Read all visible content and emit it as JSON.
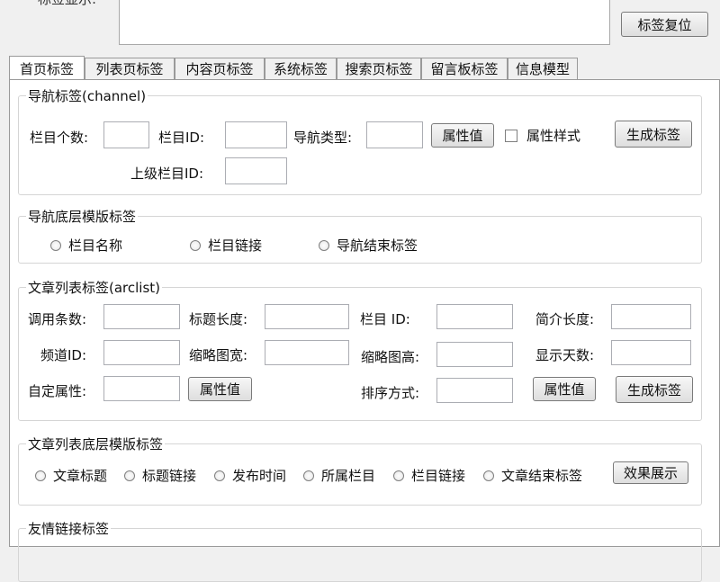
{
  "top": {
    "label": "标签显示:",
    "reset_button": "标签复位"
  },
  "tabs": [
    "首页标签",
    "列表页标签",
    "内容页标签",
    "系统标签",
    "搜索页标签",
    "留言板标签",
    "信息模型"
  ],
  "nav": {
    "title": "导航标签(channel)",
    "count_label": "栏目个数:",
    "id_label": "栏目ID:",
    "type_label": "导航类型:",
    "attr_button": "属性值",
    "style_checkbox": "属性样式",
    "generate_button": "生成标签",
    "parent_label": "上级栏目ID:"
  },
  "nav_template": {
    "title": "导航底层模版标签",
    "options": [
      "栏目名称",
      "栏目链接",
      "导航结束标签"
    ]
  },
  "arclist": {
    "title": "文章列表标签(arclist)",
    "row1": [
      "调用条数:",
      "标题长度:",
      "栏目 ID:",
      "简介长度:"
    ],
    "row2": [
      "频道ID:",
      "缩略图宽:",
      "缩略图高:",
      "显示天数:"
    ],
    "custom_label": "自定属性:",
    "attr_button": "属性值",
    "sort_label": "排序方式:",
    "attr_button2": "属性值",
    "generate_button": "生成标签"
  },
  "arclist_template": {
    "title": "文章列表底层模版标签",
    "options": [
      "文章标题",
      "标题链接",
      "发布时间",
      "所属栏目",
      "栏目链接",
      "文章结束标签"
    ],
    "preview_button": "效果展示"
  },
  "friendlink": {
    "title": "友情链接标签"
  }
}
